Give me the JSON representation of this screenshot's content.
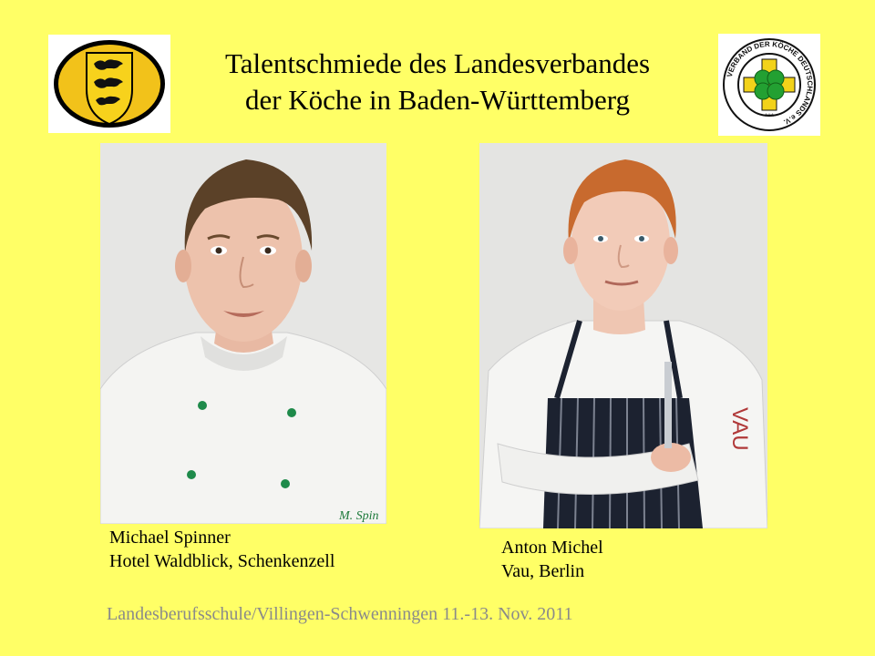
{
  "title": {
    "line1": "Talentschmiede des Landesverbandes",
    "line2": "der Köche in Baden-Württemberg"
  },
  "logos": {
    "left": "coat-of-arms-icon",
    "right": {
      "icon": "clover-icon",
      "ring_text": "VERBAND DER KÖCHE DEUTSCHLANDS e.V."
    }
  },
  "people": [
    {
      "name": "Michael Spinner",
      "workplace": "Hotel Waldblick, Schenkenzell",
      "jacket_text": "M. Spin"
    },
    {
      "name": "Anton Michel",
      "workplace": "Vau, Berlin",
      "jacket_text": "VAU"
    }
  ],
  "footer": "Landesberufsschule/Villingen-Schwenningen  11.-13. Nov. 2011",
  "colors": {
    "background": "#ffff66",
    "footer_text": "#8a8a8a",
    "logo_gold": "#f2c21a",
    "clover_green": "#23a032"
  }
}
